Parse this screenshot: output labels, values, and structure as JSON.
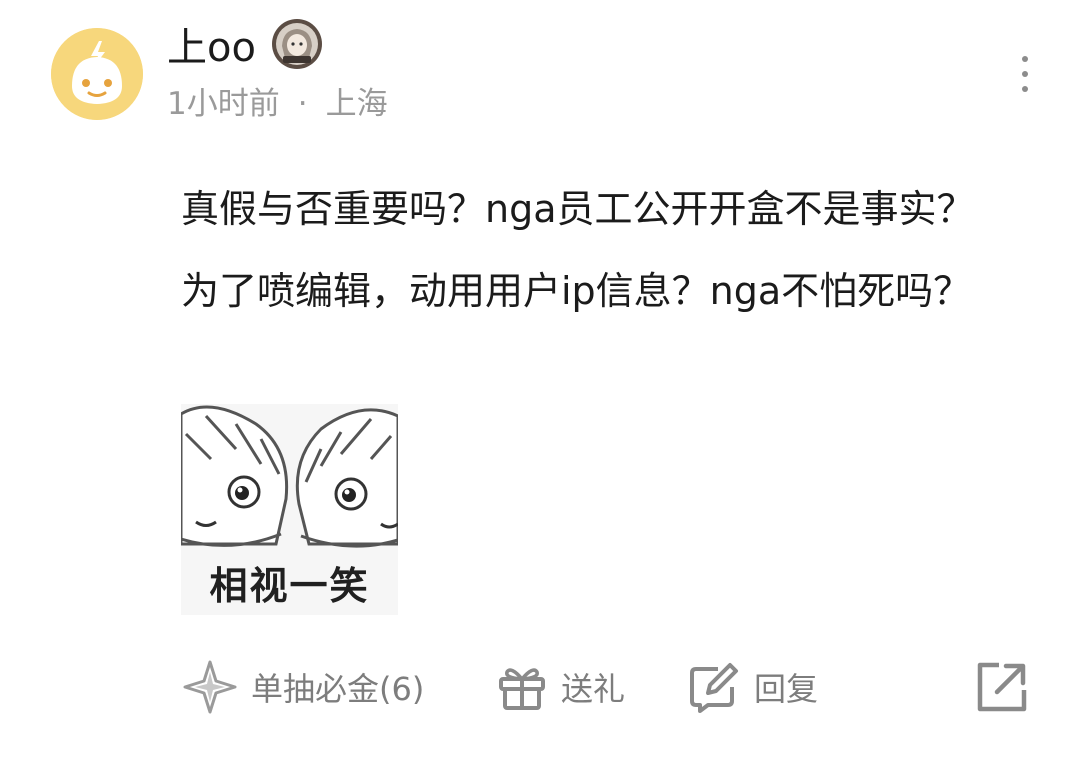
{
  "comment_header": {
    "username": "上oo",
    "time": "1小时前",
    "separator": "·",
    "location": "上海",
    "avatar_icon": "lightning-face-avatar",
    "badge_icon": "anime-character-badge",
    "more_icon": "more-vertical-icon"
  },
  "comment": {
    "text": "真假与否重要吗？nga员工公开开盒不是事实？为了喷编辑，动用用户ip信息？nga不怕死吗？",
    "sticker_caption": "相视一笑"
  },
  "actions": {
    "draw_label": "单抽必金(6)",
    "gift_label": "送礼",
    "reply_label": "回复",
    "share_icon": "share-icon"
  },
  "colors": {
    "avatar_bg": "#f7d77c",
    "meta_text": "#9a9a9a",
    "action_text": "#7d7d7d",
    "body_text": "#1b1b1b"
  }
}
